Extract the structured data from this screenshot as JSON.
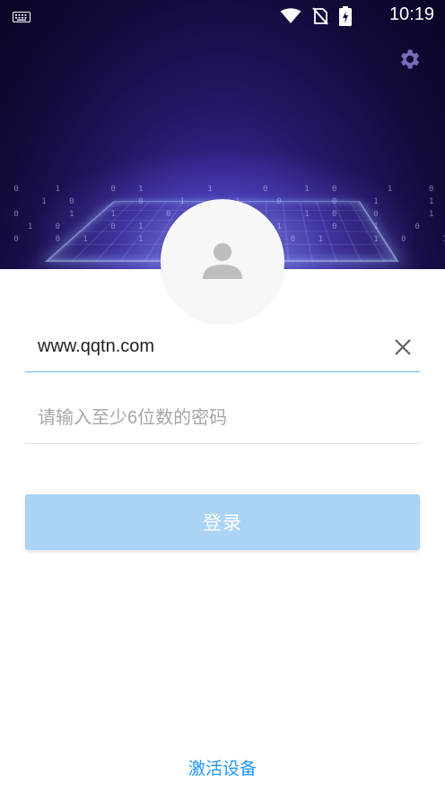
{
  "status_bar": {
    "time": "10:19",
    "icons": [
      "keyboard-icon",
      "wifi-icon",
      "no-sim-icon",
      "battery-charging-icon"
    ]
  },
  "settings": {
    "icon": "gear-icon"
  },
  "avatar": {
    "icon": "user-icon"
  },
  "login_form": {
    "username_value": "www.qqtn.com",
    "password_placeholder": "请输入至少6位数的密码",
    "login_label": "登录"
  },
  "footer": {
    "activate_label": "激活设备"
  },
  "colors": {
    "accent": "#2196f3",
    "button_bg": "#abd3f5",
    "underline_active": "#64b5f6",
    "hero_dark": "#14093a",
    "hero_light": "#6b5cff"
  }
}
